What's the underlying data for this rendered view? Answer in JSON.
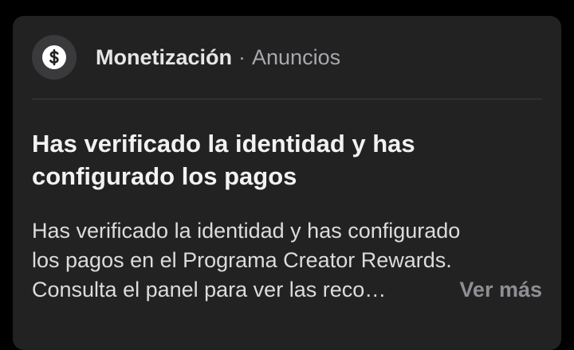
{
  "notification": {
    "icon": "dollar-icon",
    "category": "Monetización",
    "separator": "·",
    "subcategory": "Anuncios",
    "title": "Has verificado la identidad y has configurado los pagos",
    "body_lines": [
      "Has verificado la identidad y has configurado",
      "los pagos en el Programa Creator Rewards.",
      "Consulta el panel para ver las reco…"
    ],
    "see_more_label": "Ver más"
  },
  "colors": {
    "background": "#000000",
    "card": "#222223",
    "avatar": "#3a3a3c",
    "muted_text": "#8e8e93"
  }
}
